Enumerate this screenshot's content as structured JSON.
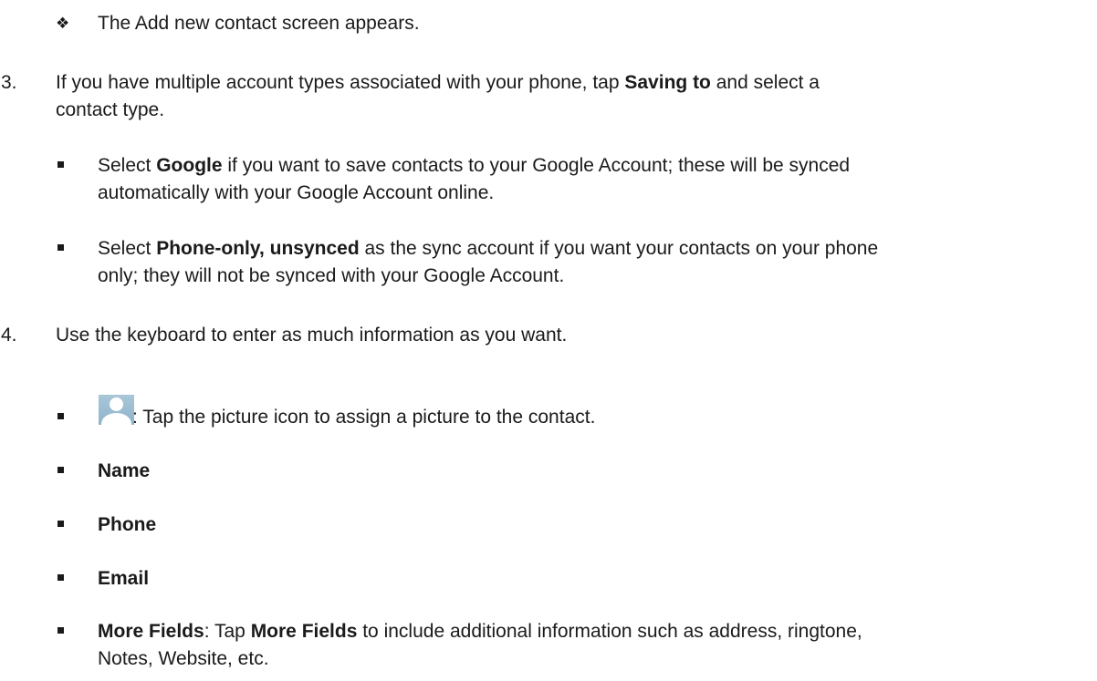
{
  "bullet1": {
    "symbol": "❖",
    "text": "The Add new contact screen appears."
  },
  "step3": {
    "num": "3.",
    "pre": "If you have multiple account types associated with your phone, tap ",
    "bold": "Saving to",
    "post": " and select a",
    "line2": "contact type."
  },
  "sub_google": {
    "pre": "Select ",
    "bold": "Google",
    "post": " if you want to save contacts to your Google Account; these will be synced",
    "line2": "automatically with your Google Account online."
  },
  "sub_phone": {
    "pre": "Select ",
    "bold": "Phone-only, unsynced",
    "post": " as the sync account if you want your contacts on your phone",
    "line2": "only; they will not be synced with your Google Account."
  },
  "step4": {
    "num": "4.",
    "text": "Use the keyboard to enter as much information as you want."
  },
  "picture_item": {
    "icon": "contact-picture-icon",
    "text": ": Tap the picture icon to assign a picture to the contact."
  },
  "fields": {
    "name": "Name",
    "phone": "Phone",
    "email": "Email"
  },
  "more_fields": {
    "bold1": "More Fields",
    "mid": ": Tap ",
    "bold2": "More Fields",
    "post": " to include additional information such as address, ringtone,",
    "line2": "Notes, Website, etc."
  }
}
